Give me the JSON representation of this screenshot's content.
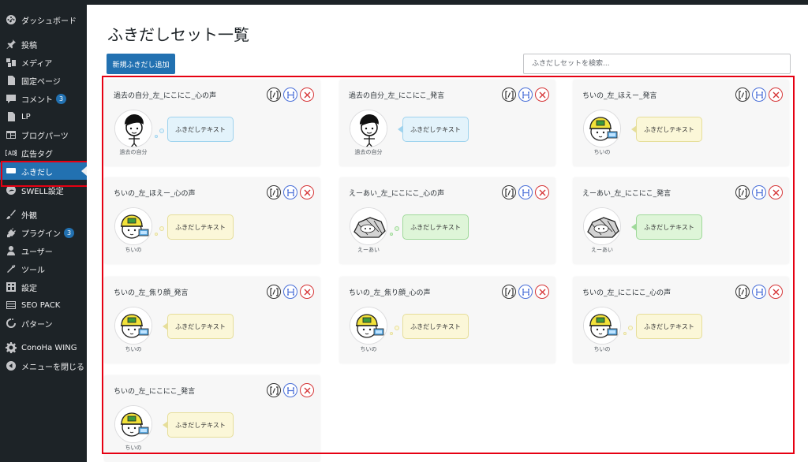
{
  "sidebar": {
    "items": [
      {
        "label": "ダッシュボード",
        "icon": "dashboard-icon",
        "badge": ""
      },
      {
        "label": "投稿",
        "icon": "pin-icon",
        "badge": ""
      },
      {
        "label": "メディア",
        "icon": "media-icon",
        "badge": ""
      },
      {
        "label": "固定ページ",
        "icon": "page-icon",
        "badge": ""
      },
      {
        "label": "コメント",
        "icon": "comment-icon",
        "badge": "3"
      },
      {
        "label": "LP",
        "icon": "document-icon",
        "badge": ""
      },
      {
        "label": "ブログパーツ",
        "icon": "layout-icon",
        "badge": ""
      },
      {
        "label": "広告タグ",
        "icon": "ad-tag-icon",
        "badge": ""
      },
      {
        "label": "ふきだし",
        "icon": "speech-bubble-icon",
        "badge": "",
        "active": true
      },
      {
        "label": "SWELL設定",
        "icon": "swell-icon",
        "badge": ""
      },
      {
        "label": "外観",
        "icon": "brush-icon",
        "badge": ""
      },
      {
        "label": "プラグイン",
        "icon": "plugin-icon",
        "badge": "3"
      },
      {
        "label": "ユーザー",
        "icon": "user-icon",
        "badge": ""
      },
      {
        "label": "ツール",
        "icon": "wrench-icon",
        "badge": ""
      },
      {
        "label": "設定",
        "icon": "settings-icon",
        "badge": ""
      },
      {
        "label": "SEO PACK",
        "icon": "list-icon",
        "badge": ""
      },
      {
        "label": "パターン",
        "icon": "pattern-icon",
        "badge": ""
      },
      {
        "label": "ConoHa WING",
        "icon": "gear-icon",
        "badge": ""
      },
      {
        "label": "メニューを閉じる",
        "icon": "collapse-icon",
        "badge": ""
      }
    ]
  },
  "main": {
    "title": "ふきだしセット一覧",
    "add_button": "新規ふきだし追加",
    "search_placeholder": "ふきだしセットを検索...",
    "cards": [
      {
        "title": "過去の自分_左_にこにこ_心の声",
        "name": "過去の自分",
        "text": "ふきだしテキスト",
        "color": "blue",
        "style": "think",
        "avatar": "person"
      },
      {
        "title": "過去の自分_左_にこにこ_発言",
        "name": "過去の自分",
        "text": "ふきだしテキスト",
        "color": "blue",
        "style": "speak",
        "avatar": "person"
      },
      {
        "title": "ちいの_左_ほえー_発言",
        "name": "ちいの",
        "text": "ふきだしテキスト",
        "color": "yellow",
        "style": "speak",
        "avatar": "helmet"
      },
      {
        "title": "ちいの_左_ほえー_心の声",
        "name": "ちいの",
        "text": "ふきだしテキスト",
        "color": "yellow",
        "style": "think",
        "avatar": "helmet"
      },
      {
        "title": "えーあい_左_にこにこ_心の声",
        "name": "えーあい",
        "text": "ふきだしテキスト",
        "color": "green",
        "style": "think",
        "avatar": "rock"
      },
      {
        "title": "えーあい_左_にこにこ_発言",
        "name": "えーあい",
        "text": "ふきだしテキスト",
        "color": "green",
        "style": "speak",
        "avatar": "rock"
      },
      {
        "title": "ちいの_左_焦り顔_発言",
        "name": "ちいの",
        "text": "ふきだしテキスト",
        "color": "yellow",
        "style": "speak",
        "avatar": "helmet"
      },
      {
        "title": "ちいの_左_焦り顔_心の声",
        "name": "ちいの",
        "text": "ふきだしテキスト",
        "color": "yellow",
        "style": "think",
        "avatar": "helmet"
      },
      {
        "title": "ちいの_左_にこにこ_心の声",
        "name": "ちいの",
        "text": "ふきだしテキスト",
        "color": "yellow",
        "style": "think",
        "avatar": "helmet"
      },
      {
        "title": "ちいの_左_にこにこ_発言",
        "name": "ちいの",
        "text": "ふきだしテキスト",
        "color": "yellow",
        "style": "speak",
        "avatar": "helmet"
      }
    ]
  },
  "colors": {
    "sidebar_bg": "#1d2327",
    "accent": "#2271b1",
    "highlight": "#e60012"
  }
}
